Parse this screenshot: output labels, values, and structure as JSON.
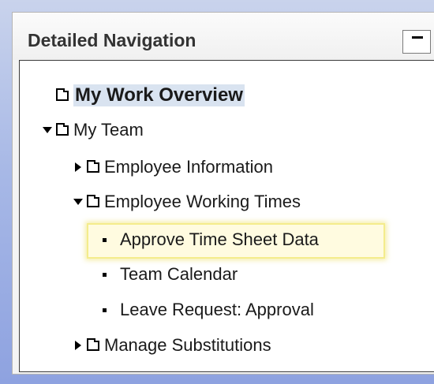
{
  "panel": {
    "title": "Detailed Navigation"
  },
  "tree": {
    "my_work_overview": "My Work Overview",
    "my_team": "My Team",
    "employee_information": "Employee Information",
    "employee_working_times": "Employee Working Times",
    "approve_time_sheet_data": "Approve Time Sheet Data",
    "team_calendar": "Team Calendar",
    "leave_request_approval": "Leave Request: Approval",
    "manage_substitutions": "Manage Substitutions"
  },
  "icons": {
    "collapse": "minimize-icon",
    "folder": "folder-icon",
    "expanded": "triangle-down-icon",
    "collapsed": "triangle-right-icon",
    "leaf": "square-bullet-icon"
  },
  "colors": {
    "selection": "#d9e3f0",
    "highlight": "#f4ec8c",
    "background_gradient_start": "#c9d3ec",
    "background_gradient_end": "#8ea2e0"
  }
}
